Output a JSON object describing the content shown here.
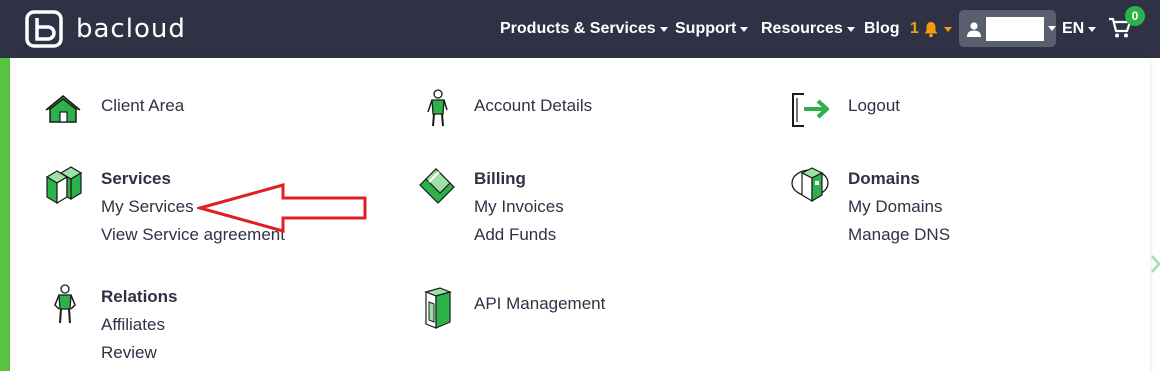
{
  "brand": {
    "name": "bacloud"
  },
  "topnav": {
    "products": "Products & Services",
    "support": "Support",
    "resources": "Resources",
    "blog": "Blog",
    "notifications_count": "1",
    "language": "EN",
    "cart_count": "0"
  },
  "menu": {
    "client_area": "Client Area",
    "account_details": "Account Details",
    "logout": "Logout",
    "services": {
      "title": "Services",
      "links": [
        "My Services",
        "View Service agreement"
      ]
    },
    "billing": {
      "title": "Billing",
      "links": [
        "My Invoices",
        "Add Funds"
      ]
    },
    "domains": {
      "title": "Domains",
      "links": [
        "My Domains",
        "Manage DNS"
      ]
    },
    "relations": {
      "title": "Relations",
      "links": [
        "Affiliates",
        "Review"
      ]
    },
    "api_management": "API Management"
  },
  "colors": {
    "topbar": "#2e3244",
    "accent_green": "#2db14a",
    "notification": "#f39c12",
    "annotation_arrow": "#e02020"
  }
}
